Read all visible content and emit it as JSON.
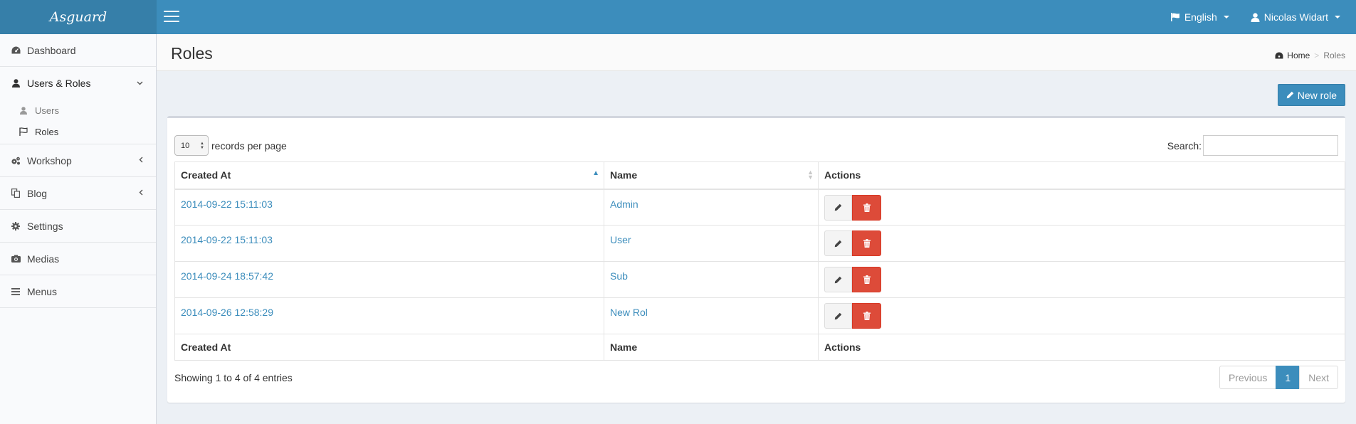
{
  "app": {
    "logo": "Asguard"
  },
  "topbar": {
    "language": "English",
    "user": "Nicolas Widart"
  },
  "sidebar": {
    "items": [
      {
        "label": "Dashboard",
        "icon": "dashboard-icon"
      },
      {
        "label": "Users & Roles",
        "icon": "user-icon"
      },
      {
        "label": "Workshop",
        "icon": "cogs-icon"
      },
      {
        "label": "Blog",
        "icon": "copy-icon"
      },
      {
        "label": "Settings",
        "icon": "cog-icon"
      },
      {
        "label": "Medias",
        "icon": "camera-icon"
      },
      {
        "label": "Menus",
        "icon": "bars-icon"
      }
    ],
    "subitems": [
      {
        "label": "Users",
        "icon": "user-icon"
      },
      {
        "label": "Roles",
        "icon": "flag-icon"
      }
    ]
  },
  "page": {
    "title": "Roles"
  },
  "breadcrumb": {
    "home": "Home",
    "current": "Roles"
  },
  "toolbar": {
    "new_role_label": "New role"
  },
  "table": {
    "length_value": "10",
    "length_label": "records per page",
    "search_label": "Search:",
    "columns": [
      "Created At",
      "Name",
      "Actions"
    ],
    "rows": [
      {
        "created_at": "2014-09-22 15:11:03",
        "name": "Admin"
      },
      {
        "created_at": "2014-09-22 15:11:03",
        "name": "User"
      },
      {
        "created_at": "2014-09-24 18:57:42",
        "name": "Sub"
      },
      {
        "created_at": "2014-09-26 12:58:29",
        "name": "New Rol"
      }
    ],
    "info": "Showing 1 to 4 of 4 entries",
    "pagination": {
      "previous": "Previous",
      "current": "1",
      "next": "Next"
    }
  }
}
